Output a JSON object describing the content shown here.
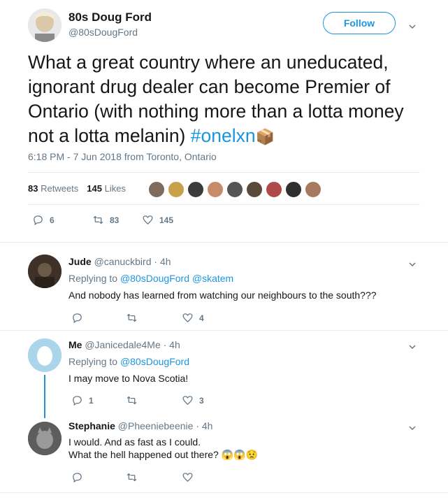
{
  "main_tweet": {
    "name": "80s Doug Ford",
    "handle": "@80sDougFord",
    "follow_label": "Follow",
    "text": "What a great country where an uneducated, ignorant drug dealer can become Premier of Ontario (with nothing more than a lotta money not a lotta melanin) ",
    "hashtag": "#onelxn",
    "hashtag_emoji": "📦",
    "timestamp": "6:18 PM - 7 Jun 2018 from Toronto, Ontario",
    "retweets_count": "83",
    "retweets_label": "Retweets",
    "likes_count": "145",
    "likes_label": "Likes",
    "actions": {
      "replies": "6",
      "retweets": "83",
      "likes": "145"
    }
  },
  "replies": [
    {
      "name": "Jude",
      "handle": "@canuckbird",
      "time": "· 4h",
      "replying_label": "Replying to",
      "replying_to": "@80sDougFord @skatem",
      "text": "And nobody has learned from watching our neighbours to the south???",
      "replies": "",
      "retweets": "",
      "likes": "4"
    },
    {
      "name": "Me",
      "handle": "@Janicedale4Me",
      "time": "· 4h",
      "replying_label": "Replying to",
      "replying_to": "@80sDougFord",
      "text": "I may move to Nova Scotia!",
      "replies": "1",
      "retweets": "",
      "likes": "3"
    },
    {
      "name": "Stephanie",
      "handle": "@Pheeniebeenie",
      "time": "· 4h",
      "text_line1": "I would. And as fast as I could.",
      "text_line2": "What the hell happened out there? ",
      "emojis": "😱😱😟",
      "replies": "",
      "retweets": "",
      "likes": ""
    }
  ],
  "colors": {
    "accent": "#1b95e0",
    "text": "#14171a",
    "muted": "#657786",
    "divider": "#e6ecf0"
  }
}
